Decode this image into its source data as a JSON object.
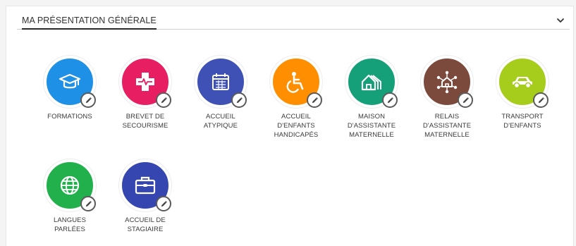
{
  "section": {
    "title": "MA PRÉSENTATION GÉNÉRALE",
    "chevron_icon": "chevron-down-icon"
  },
  "tiles": [
    {
      "id": "formations",
      "lines": [
        "FORMATIONS"
      ],
      "color": "#1e90e6",
      "icon": "graduation-cap-icon"
    },
    {
      "id": "brevet-de-secourisme",
      "lines": [
        "BREVET DE",
        "SECOURISME"
      ],
      "color": "#e81e63",
      "icon": "medical-cross-icon"
    },
    {
      "id": "accueil-atypique",
      "lines": [
        "ACCUEIL",
        "ATYPIQUE"
      ],
      "color": "#3f51b5",
      "icon": "calendar-icon"
    },
    {
      "id": "accueil-enfants-handicapes",
      "lines": [
        "ACCUEIL",
        "D'ENFANTS",
        "HANDICAPÉS"
      ],
      "color": "#ff8f00",
      "icon": "wheelchair-icon"
    },
    {
      "id": "maison-assistante-maternelle",
      "lines": [
        "MAISON",
        "D'ASSISTANTE",
        "MATERNELLE"
      ],
      "color": "#15a07a",
      "icon": "houses-icon"
    },
    {
      "id": "relais-assistante-maternelle",
      "lines": [
        "RELAIS",
        "D'ASSISTANTE",
        "MATERNELLE"
      ],
      "color": "#7b4a3c",
      "icon": "house-network-icon"
    },
    {
      "id": "transport-enfants",
      "lines": [
        "TRANSPORT",
        "D'ENFANTS"
      ],
      "color": "#a6cc1c",
      "icon": "car-icon"
    },
    {
      "id": "langues-parlees",
      "lines": [
        "LANGUES",
        "PARLÉES"
      ],
      "color": "#22b04c",
      "icon": "globe-icon"
    },
    {
      "id": "accueil-de-stagiaire",
      "lines": [
        "ACCUEIL DE",
        "STAGIAIRE"
      ],
      "color": "#3546b0",
      "icon": "briefcase-icon"
    }
  ],
  "edit_icon": "pencil-icon"
}
